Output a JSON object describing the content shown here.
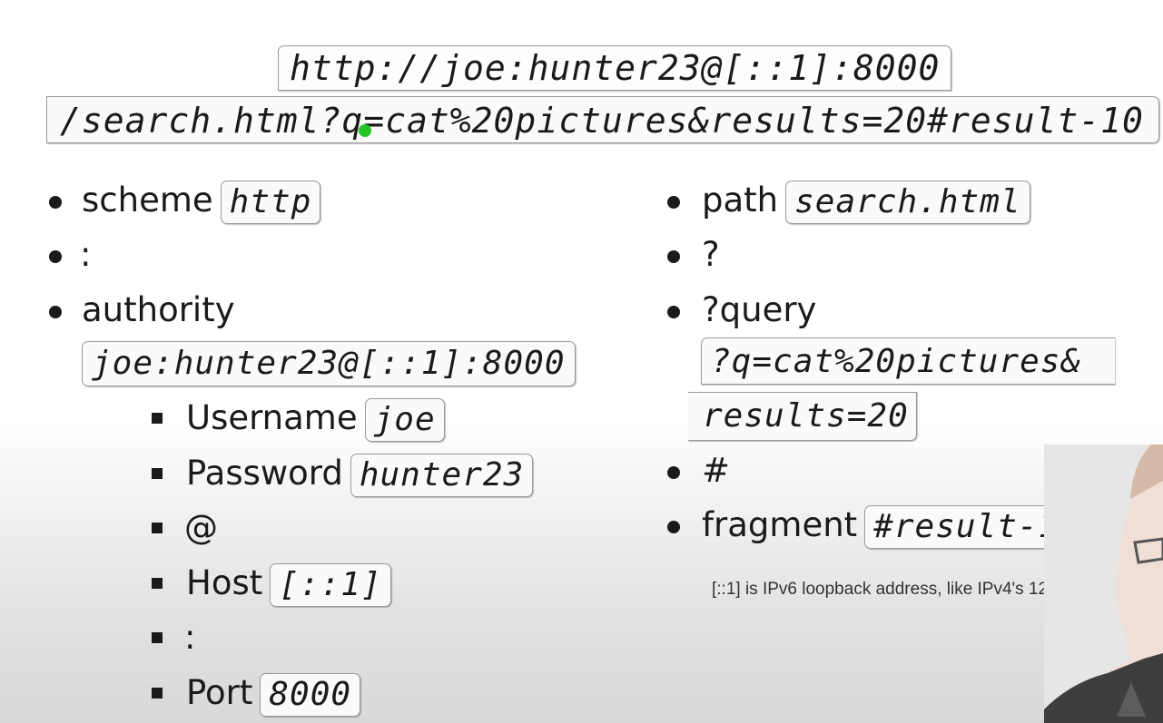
{
  "url": {
    "line1": "http://joe:hunter23@[::1]:8000",
    "line2": "/search.html?q=cat%20pictures&results=20#result-10"
  },
  "left": {
    "scheme": {
      "label": "scheme",
      "value": "http"
    },
    "colon": ":",
    "authority": {
      "label": "authority",
      "value": "joe:hunter23@[::1]:8000"
    },
    "sub": {
      "username": {
        "label": "Username",
        "value": "joe"
      },
      "password": {
        "label": "Password",
        "value": "hunter23"
      },
      "at": "@",
      "host": {
        "label": "Host",
        "value": "[::1]"
      },
      "colon": ":",
      "port": {
        "label": "Port",
        "value": "8000"
      }
    }
  },
  "right": {
    "path": {
      "label": "path",
      "value": "search.html"
    },
    "question": "?",
    "query": {
      "label": "?query",
      "value_line1": "?q=cat%20pictures&",
      "value_line2": "results=20"
    },
    "hash": "#",
    "fragment": {
      "label": "fragment",
      "value": "#result-10"
    }
  },
  "note": "[::1] is IPv6 loopback address, like IPv4's 127.0.0.1",
  "colors": {
    "cursor": "#27c427",
    "text": "#1a1a1a",
    "box_border": "#9a9a9a"
  }
}
